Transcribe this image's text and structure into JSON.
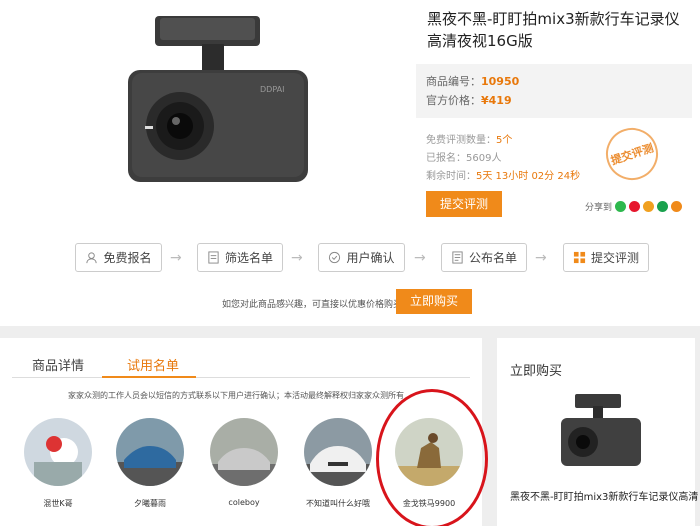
{
  "product": {
    "title": "黑夜不黑-盯盯拍mix3新款行车记录仪高清夜视16G版",
    "code_label": "商品编号：",
    "code_value": "10950",
    "price_label": "官方价格：",
    "price_value": "¥419"
  },
  "info": {
    "free_count_label": "免费评测数量：",
    "free_count_value": "5个",
    "signed_label": "已报名：",
    "signed_value": "5609人",
    "remaining_label": "剩余时间：",
    "remaining_value": "5天 13小时 02分 24秒"
  },
  "stamp_text": "提交评测",
  "submit_label": "提交评测",
  "share_label": "分享到",
  "steps": [
    {
      "label": "免费报名"
    },
    {
      "label": "筛选名单"
    },
    {
      "label": "用户确认"
    },
    {
      "label": "公布名单"
    },
    {
      "label": "提交评测"
    }
  ],
  "buy": {
    "note": "如您对此商品感兴趣，可直接以优惠价格购买。",
    "button": "立即购买"
  },
  "tabs": {
    "details": "商品详情",
    "trial_list": "试用名单"
  },
  "notice": "家家众测的工作人员会以短信的方式联系以下用户进行确认；本活动最终解释权归家家众测所有",
  "users": [
    {
      "name": "混世K哥"
    },
    {
      "name": "夕曦暮雨"
    },
    {
      "name": "coleboy"
    },
    {
      "name": "不知道叫什么好哦"
    },
    {
      "name": "金戈铁马9900"
    }
  ],
  "sidebar": {
    "title": "立即购买",
    "product_name": "黑夜不黑-盯盯拍mix3新款行车记录仪高清"
  },
  "colors": {
    "accent": "#f08a1a",
    "highlight": "#e8780b",
    "annotation": "#d8141b"
  }
}
